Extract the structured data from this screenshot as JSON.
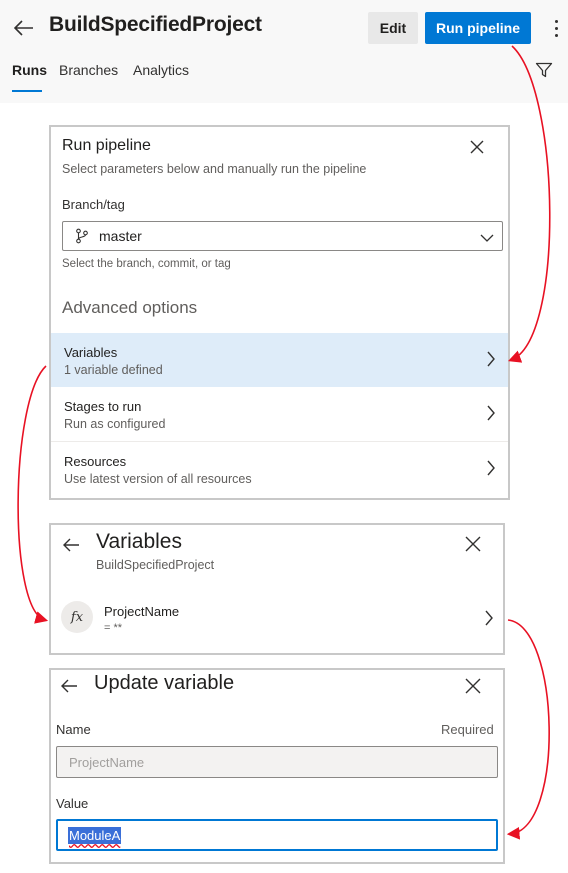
{
  "header": {
    "title": "BuildSpecifiedProject",
    "edit_label": "Edit",
    "run_label": "Run pipeline",
    "tabs": [
      {
        "label": "Runs",
        "active": true
      },
      {
        "label": "Branches",
        "active": false
      },
      {
        "label": "Analytics",
        "active": false
      }
    ]
  },
  "run_panel": {
    "title": "Run pipeline",
    "subtitle": "Select parameters below and manually run the pipeline",
    "branch_label": "Branch/tag",
    "branch_value": "master",
    "branch_helper": "Select the branch, commit, or tag",
    "advanced_label": "Advanced options",
    "options": [
      {
        "title": "Variables",
        "subtitle": "1 variable defined",
        "selected": true
      },
      {
        "title": "Stages to run",
        "subtitle": "Run as configured",
        "selected": false
      },
      {
        "title": "Resources",
        "subtitle": "Use latest version of all resources",
        "selected": false
      }
    ]
  },
  "variables_panel": {
    "title": "Variables",
    "subtitle": "BuildSpecifiedProject",
    "items": [
      {
        "icon_text": "fx",
        "name": "ProjectName",
        "value": "= **"
      }
    ]
  },
  "update_panel": {
    "title": "Update variable",
    "name_label": "Name",
    "required_label": "Required",
    "name_value": "ProjectName",
    "value_label": "Value",
    "value_value": "ModuleA"
  },
  "colors": {
    "accent": "#0078d4",
    "annotation": "#e81123",
    "selected_row": "#deecf9"
  },
  "icons": [
    "back-arrow-icon",
    "more-vertical-icon",
    "filter-icon",
    "close-icon",
    "branch-icon",
    "chevron-down-icon",
    "chevron-right-icon",
    "function-icon"
  ]
}
